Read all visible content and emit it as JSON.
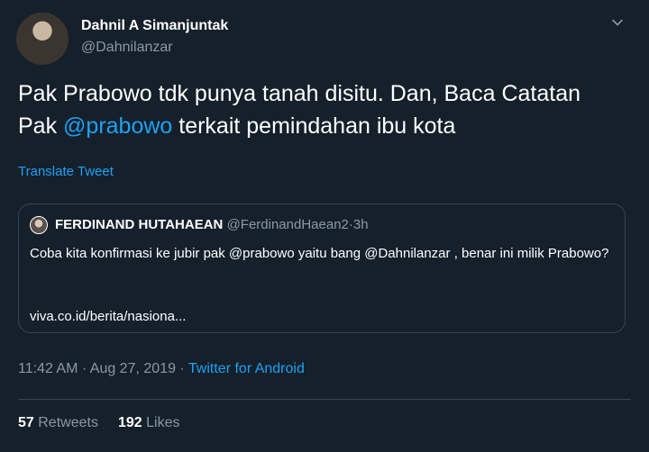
{
  "author": {
    "name": "Dahnil A Simanjuntak",
    "handle": "@Dahnilanzar"
  },
  "tweet": {
    "text_line1": "Pak Prabowo tdk punya tanah disitu. Dan, Baca Catatan",
    "text_line2_pre": "Pak ",
    "text_line2_mention": "@prabowo",
    "text_line2_post": " terkait pemindahan ibu kota",
    "translate_label": "Translate Tweet"
  },
  "quoted": {
    "name": "FERDINAND HUTAHAEAN",
    "handle": "@FerdinandHaean2",
    "separator": "·",
    "time": "3h",
    "text": "Coba kita konfirmasi ke jubir pak @prabowo yaitu bang @Dahnilanzar , benar ini milik Prabowo?",
    "link": "viva.co.id/berita/nasiona..."
  },
  "meta": {
    "time": "11:42 AM",
    "separator": "·",
    "date": "Aug 27, 2019",
    "source": "Twitter for Android"
  },
  "stats": {
    "retweets_count": "57",
    "retweets_label": "Retweets",
    "likes_count": "192",
    "likes_label": "Likes"
  },
  "colors": {
    "background": "#15202b",
    "accent": "#1da1f2",
    "secondary_text": "#8899a6",
    "border": "#38444d"
  },
  "icons": {
    "caret": "chevron-down-icon"
  }
}
